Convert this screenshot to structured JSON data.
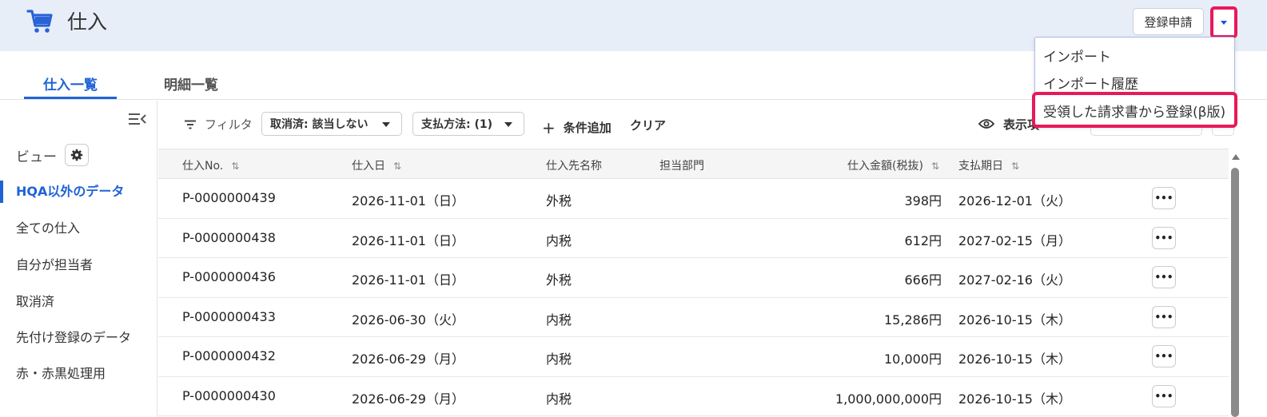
{
  "header": {
    "title": "仕入",
    "register_button": "登録申請"
  },
  "dropdown_menu": {
    "items": [
      "インポート",
      "インポート履歴",
      "受領した請求書から登録(β版)"
    ]
  },
  "tabs": [
    {
      "label": "仕入一覧",
      "active": true
    },
    {
      "label": "明細一覧",
      "active": false
    }
  ],
  "sidebar": {
    "view_label": "ビュー",
    "items": [
      {
        "label": "HQA以外のデータ",
        "active": true
      },
      {
        "label": "全ての仕入",
        "active": false
      },
      {
        "label": "自分が担当者",
        "active": false
      },
      {
        "label": "取消済",
        "active": false
      },
      {
        "label": "先付け登録のデータ",
        "active": false
      },
      {
        "label": "赤・赤黒処理用",
        "active": false
      }
    ]
  },
  "filterbar": {
    "filter_label": "フィルタ",
    "chips": [
      "取消済: 該当しない",
      "支払方法: (1)"
    ],
    "add_condition": "条件追加",
    "clear": "クリア",
    "display_label": "表示項"
  },
  "table": {
    "columns": [
      "仕入No.",
      "仕入日",
      "仕入先名称",
      "担当部門",
      "仕入金額(税抜)",
      "支払期日"
    ],
    "rows": [
      {
        "no": "P-0000000439",
        "date": "2026-11-01（日）",
        "supplier": "外税",
        "dept": "",
        "amount": "398円",
        "due": "2026-12-01（火）"
      },
      {
        "no": "P-0000000438",
        "date": "2026-11-01（日）",
        "supplier": "内税",
        "dept": "",
        "amount": "612円",
        "due": "2027-02-15（月）"
      },
      {
        "no": "P-0000000436",
        "date": "2026-11-01（日）",
        "supplier": "外税",
        "dept": "",
        "amount": "666円",
        "due": "2027-02-16（火）"
      },
      {
        "no": "P-0000000433",
        "date": "2026-06-30（火）",
        "supplier": "内税",
        "dept": "",
        "amount": "15,286円",
        "due": "2026-10-15（木）"
      },
      {
        "no": "P-0000000432",
        "date": "2026-06-29（月）",
        "supplier": "内税",
        "dept": "",
        "amount": "10,000円",
        "due": "2026-10-15（木）"
      },
      {
        "no": "P-0000000430",
        "date": "2026-06-29（月）",
        "supplier": "内税",
        "dept": "",
        "amount": "1,000,000,000円",
        "due": "2026-10-15（木）"
      }
    ],
    "more_label": "•••"
  },
  "colors": {
    "accent": "#1f63d6",
    "highlight": "#e8195a",
    "header_bg": "#e8eef8"
  }
}
